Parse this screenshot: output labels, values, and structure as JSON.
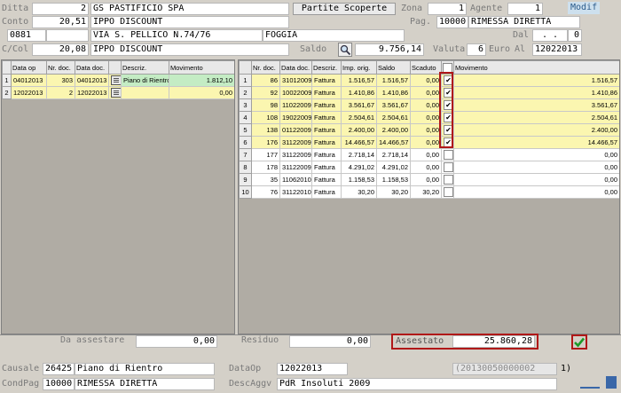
{
  "header": {
    "ditta_label": "Ditta",
    "ditta_code": "2",
    "ditta_name": "GS PASTIFICIO SPA",
    "partite_btn": "Partite Scoperte",
    "zona_label": "Zona",
    "zona_value": "1",
    "agente_label": "Agente",
    "agente_value": "1",
    "modif": "Modif",
    "conto_label": "Conto",
    "conto_value": "20,51",
    "conto_name": "IPPO DISCOUNT",
    "pag_label": "Pag.",
    "pag_code": "10000",
    "pag_name": "RIMESSA DIRETTA",
    "conto2_code": "0881",
    "address": "VIA S. PELLICO N.74/76",
    "city": "FOGGIA",
    "dal_label": "Dal",
    "dal_value": ". .",
    "dal_num": "0",
    "ccol_label": "C/Col",
    "ccol_value": "20,08",
    "ccol_name": "IPPO DISCOUNT",
    "saldo_label": "Saldo",
    "saldo_value": "9.756,14",
    "valuta_label": "Valuta",
    "valuta_value": "6",
    "valuta_cur": "Euro",
    "al_label": "Al",
    "al_value": "12022013"
  },
  "left_grid": {
    "columns": [
      "Data op",
      "Nr. doc.",
      "Data doc.",
      "",
      "Descriz.",
      "Movimento"
    ],
    "rows": [
      {
        "idx": "1",
        "data_op": "04012013",
        "nr_doc": "303",
        "data_doc": "04012013",
        "descriz": "Piano di Rientro",
        "movimento": "1.812,10"
      },
      {
        "idx": "2",
        "data_op": "12022013",
        "nr_doc": "2",
        "data_doc": "12022013",
        "descriz": "",
        "movimento": "0,00"
      }
    ]
  },
  "right_grid": {
    "columns": [
      "Nr. doc.",
      "Data doc.",
      "Descriz.",
      "Imp. orig.",
      "Saldo",
      "Scaduto",
      "",
      "Movimento"
    ],
    "rows": [
      {
        "idx": "1",
        "nr": "86",
        "data": "31012009",
        "descriz": "Fattura",
        "imp": "1.516,57",
        "saldo": "1.516,57",
        "scaduto": "0,00",
        "checked": "✔",
        "movimento": "1.516,57"
      },
      {
        "idx": "2",
        "nr": "92",
        "data": "10022009",
        "descriz": "Fattura",
        "imp": "1.410,86",
        "saldo": "1.410,86",
        "scaduto": "0,00",
        "checked": "✔",
        "movimento": "1.410,86"
      },
      {
        "idx": "3",
        "nr": "98",
        "data": "11022009",
        "descriz": "Fattura",
        "imp": "3.561,67",
        "saldo": "3.561,67",
        "scaduto": "0,00",
        "checked": "✔",
        "movimento": "3.561,67"
      },
      {
        "idx": "4",
        "nr": "108",
        "data": "19022009",
        "descriz": "Fattura",
        "imp": "2.504,61",
        "saldo": "2.504,61",
        "scaduto": "0,00",
        "checked": "✔",
        "movimento": "2.504,61"
      },
      {
        "idx": "5",
        "nr": "138",
        "data": "01122009",
        "descriz": "Fattura",
        "imp": "2.400,00",
        "saldo": "2.400,00",
        "scaduto": "0,00",
        "checked": "✔",
        "movimento": "2.400,00"
      },
      {
        "idx": "6",
        "nr": "176",
        "data": "31122009",
        "descriz": "Fattura",
        "imp": "14.466,57",
        "saldo": "14.466,57",
        "scaduto": "0,00",
        "checked": "✔",
        "movimento": "14.466,57"
      },
      {
        "idx": "7",
        "nr": "177",
        "data": "31122009",
        "descriz": "Fattura",
        "imp": "2.718,14",
        "saldo": "2.718,14",
        "scaduto": "0,00",
        "checked": "",
        "movimento": "0,00"
      },
      {
        "idx": "8",
        "nr": "178",
        "data": "31122009",
        "descriz": "Fattura",
        "imp": "4.291,02",
        "saldo": "4.291,02",
        "scaduto": "0,00",
        "checked": "",
        "movimento": "0,00"
      },
      {
        "idx": "9",
        "nr": "35",
        "data": "11062010",
        "descriz": "Fattura",
        "imp": "1.158,53",
        "saldo": "1.158,53",
        "scaduto": "0,00",
        "checked": "",
        "movimento": "0,00"
      },
      {
        "idx": "10",
        "nr": "76",
        "data": "31122010",
        "descriz": "Fattura",
        "imp": "30,20",
        "saldo": "30,20",
        "scaduto": "30,20",
        "checked": "",
        "movimento": "0,00"
      }
    ]
  },
  "totals": {
    "da_assestare_label": "Da assestare",
    "da_assestare_value": "0,00",
    "residuo_label": "Residuo",
    "residuo_value": "0,00",
    "assestato_label": "Assestato",
    "assestato_value": "25.860,28"
  },
  "footer": {
    "causale_label": "Causale",
    "causale_code": "26425",
    "causale_name": "Piano di Rientro",
    "dataop_label": "DataOp",
    "dataop_value": "12022013",
    "ref_value": "(20130050000002",
    "ref_suffix": "1)",
    "condpag_label": "CondPag",
    "condpag_code": "10000",
    "condpag_name": "RIMESSA DIRETTA",
    "descaggv_label": "DescAggv",
    "descaggv_value": "PdR Insoluti 2009"
  },
  "colors": {
    "yellow_row": "#fbf6b0",
    "green_cell": "#c4ecc4",
    "highlight_red": "#b01818"
  }
}
